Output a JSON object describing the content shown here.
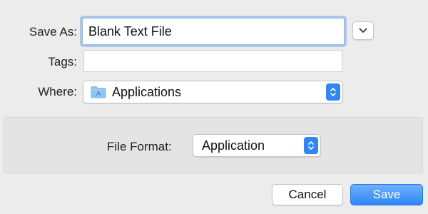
{
  "dialog": {
    "save_as_label": "Save As:",
    "save_as_value": "Blank Text File",
    "tags_label": "Tags:",
    "tags_value": "",
    "where_label": "Where:",
    "where_value": "Applications",
    "where_icon": "folder-icon",
    "expand_icon": "chevron-down-icon"
  },
  "options": {
    "file_format_label": "File Format:",
    "file_format_value": "Application"
  },
  "buttons": {
    "cancel_label": "Cancel",
    "save_label": "Save"
  },
  "colors": {
    "accent": "#2f87f5",
    "focus_ring": "#a9c7ee",
    "window_bg": "#ececec"
  }
}
